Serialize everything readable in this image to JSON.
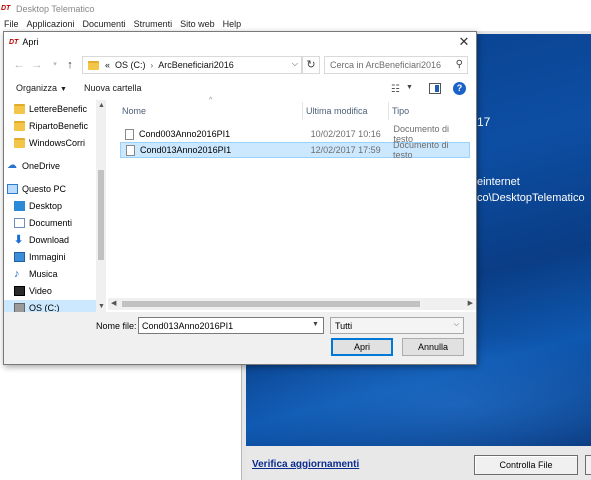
{
  "app": {
    "logo": "DT",
    "title": "Desktop Telematico",
    "menu": [
      "File",
      "Applicazioni",
      "Documenti",
      "Strumenti",
      "Sito web",
      "Help"
    ],
    "panel_text_1": "17",
    "panel_text_2": "einternet",
    "panel_text_3": "co\\DesktopTelematico",
    "update_link": "Verifica aggiornamenti",
    "check_button": "Controlla File"
  },
  "dialog": {
    "logo": "DT",
    "title": "Apri",
    "address": {
      "prefix": "«",
      "segments": [
        "OS (C:)",
        "ArcBeneficiari2016"
      ]
    },
    "search_placeholder": "Cerca in ArcBeneficiari2016",
    "toolbar": {
      "organize": "Organizza",
      "new_folder": "Nuova cartella",
      "help": "?"
    },
    "nav_items": [
      {
        "label": "LettereBenefic",
        "icon": "folder-icon"
      },
      {
        "label": "RipartoBenefic",
        "icon": "folder-icon"
      },
      {
        "label": "WindowsCorri",
        "icon": "folder-icon"
      },
      {
        "label": "OneDrive",
        "icon": "cloud-icon"
      },
      {
        "label": "Questo PC",
        "icon": "computer-icon"
      },
      {
        "label": "Desktop",
        "icon": "desktop-icon"
      },
      {
        "label": "Documenti",
        "icon": "documents-icon"
      },
      {
        "label": "Download",
        "icon": "download-icon"
      },
      {
        "label": "Immagini",
        "icon": "pictures-icon"
      },
      {
        "label": "Musica",
        "icon": "music-icon"
      },
      {
        "label": "Video",
        "icon": "video-icon"
      },
      {
        "label": "OS (C:)",
        "icon": "drive-icon"
      }
    ],
    "columns": {
      "name": "Nome",
      "modified": "Ultima modifica",
      "type": "Tipo"
    },
    "files": [
      {
        "name": "Cond003Anno2016PI1",
        "modified": "10/02/2017 10:16",
        "type": "Documento di testo"
      },
      {
        "name": "Cond013Anno2016PI1",
        "modified": "12/02/2017 17:59",
        "type": "Documento di testo"
      }
    ],
    "filename_label": "Nome file:",
    "filename_value": "Cond013Anno2016PI1",
    "filter_value": "Tutti",
    "open_button": "Apri",
    "cancel_button": "Annulla"
  }
}
